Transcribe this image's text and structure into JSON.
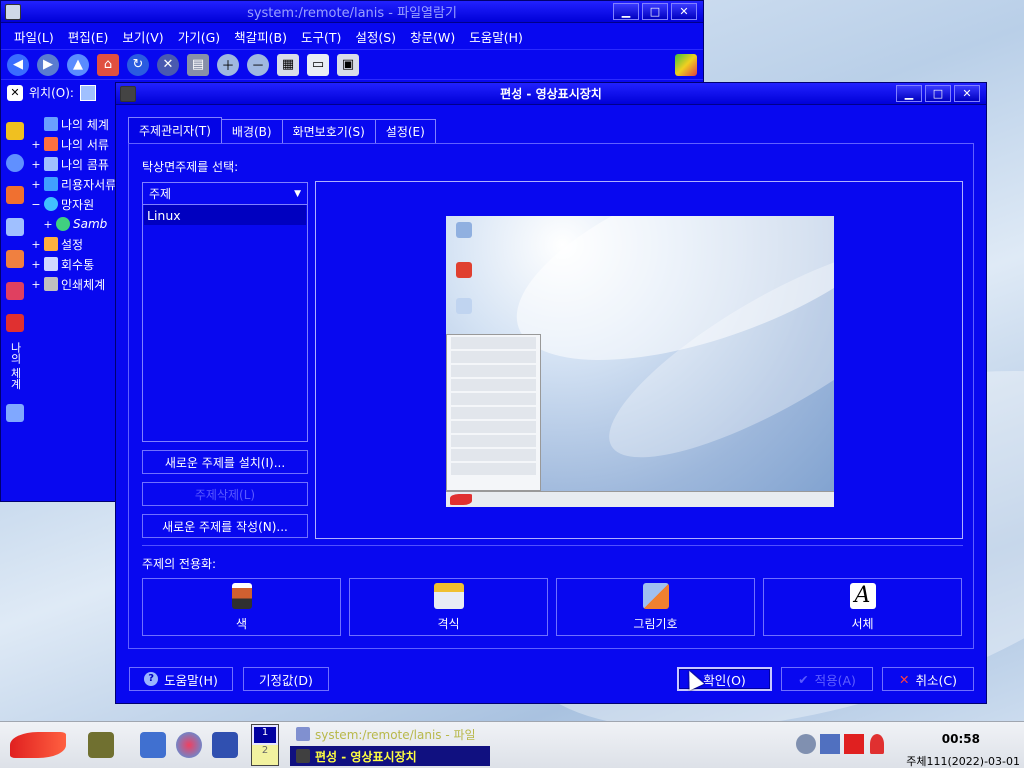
{
  "file_manager": {
    "title": "system:/remote/lanis - 파일열람기",
    "menu": [
      "파일(L)",
      "편집(E)",
      "보기(V)",
      "가기(G)",
      "책갈피(B)",
      "도구(T)",
      "설정(S)",
      "창문(W)",
      "도움말(H)"
    ],
    "location_label": "위치(O):",
    "sidebar_vertical_label": "나의 체계",
    "tree": [
      {
        "expander": "",
        "label": "나의 체계",
        "icon_color": "#6aa0ff"
      },
      {
        "expander": "+",
        "label": "나의 서류",
        "icon_color": "#ff7040"
      },
      {
        "expander": "+",
        "label": "나의 콤퓨",
        "icon_color": "#a0c0ff"
      },
      {
        "expander": "+",
        "label": "리용자서류",
        "icon_color": "#40a0ff"
      },
      {
        "expander": "−",
        "label": "망자원",
        "icon_color": "#40c0ff"
      },
      {
        "expander": "+",
        "label": "Samb",
        "icon_color": "#40d080",
        "italic": true
      },
      {
        "expander": "+",
        "label": "설정",
        "icon_color": "#ffb040"
      },
      {
        "expander": "+",
        "label": "회수통",
        "icon_color": "#d0d8ff"
      },
      {
        "expander": "+",
        "label": "인쇄체계",
        "icon_color": "#c0c0c0"
      }
    ],
    "window_buttons": [
      "▁",
      "□",
      "✕"
    ]
  },
  "dialog": {
    "title": "편성 - 영상표시장치",
    "window_buttons": [
      "▁",
      "□",
      "✕"
    ],
    "tabs": [
      "주제관리자(T)",
      "배경(B)",
      "화면보호기(S)",
      "설정(E)"
    ],
    "active_tab": 0,
    "select_label": "탁상면주제를 선택:",
    "list_header": "주제",
    "themes": [
      "Linux"
    ],
    "selected_theme": "Linux",
    "install_button": "새로운 주제를 설치(I)...",
    "delete_button": "주제삭제(L)",
    "create_button": "새로운 주제를 작성(N)...",
    "customize_label": "주제의 전용화:",
    "customize_buttons": [
      {
        "label": "색",
        "icon": "color-scheme-icon",
        "color": "#d06030"
      },
      {
        "label": "격식",
        "icon": "style-icon",
        "color": "#f0c030"
      },
      {
        "label": "그림기호",
        "icon": "icons-icon",
        "color": "#f08030"
      },
      {
        "label": "서체",
        "icon": "font-icon",
        "color": "#ffffff"
      }
    ],
    "help_button": "도움말(H)",
    "defaults_button": "기정값(D)",
    "ok_button": "확인(O)",
    "apply_button": "적용(A)",
    "cancel_button": "취소(C)"
  },
  "taskbar": {
    "pager": [
      "1",
      "2"
    ],
    "tasks": [
      "system:/remote/lanis - 파일",
      "편성 - 영상표시장치"
    ],
    "clock": "00:58",
    "date": "주체111(2022)-03-01"
  },
  "colors": {
    "window_bg": "#0808f0",
    "taskbar_bg": "#e6e9ee",
    "accent": "#ffff40"
  }
}
